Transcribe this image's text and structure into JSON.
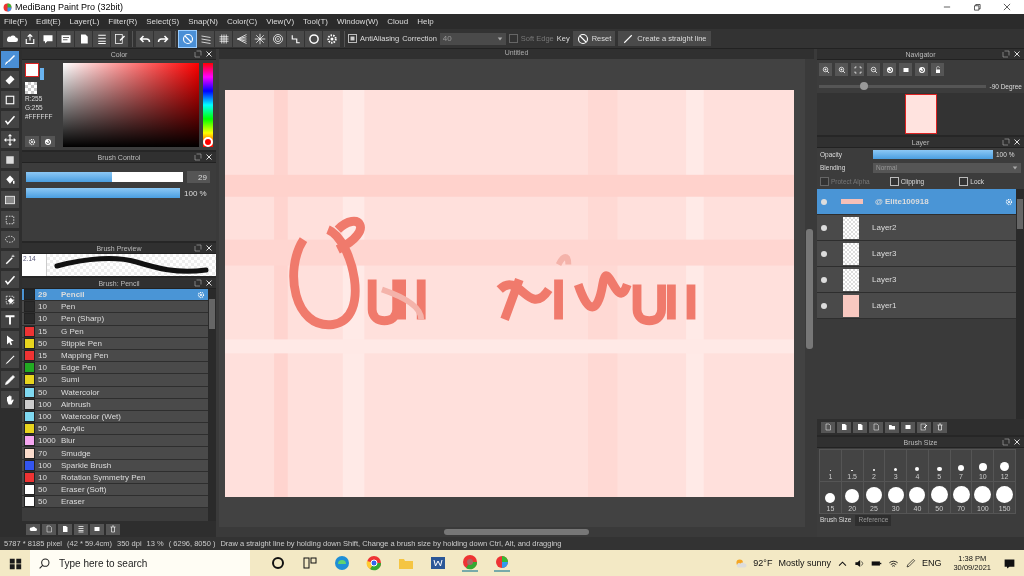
{
  "window": {
    "title": "MediBang Paint Pro (32bit)"
  },
  "menu": [
    "File(F)",
    "Edit(E)",
    "Layer(L)",
    "Filter(R)",
    "Select(S)",
    "Snap(N)",
    "Color(C)",
    "View(V)",
    "Tool(T)",
    "Window(W)",
    "Cloud",
    "Help"
  ],
  "toolbar": {
    "file_buttons": [
      {
        "kind": "cloud"
      },
      {
        "kind": "share"
      },
      {
        "kind": "comment"
      },
      {
        "kind": "note"
      },
      {
        "kind": "page"
      },
      {
        "kind": "list"
      },
      {
        "kind": "edit"
      }
    ],
    "history_buttons": [
      {
        "kind": "undo"
      },
      {
        "kind": "redo"
      }
    ],
    "snap_buttons": [
      {
        "kind": "off",
        "selected": true
      },
      {
        "kind": "parallel",
        "selected": false
      },
      {
        "kind": "grid",
        "selected": false
      },
      {
        "kind": "perspective",
        "selected": false
      },
      {
        "kind": "radial",
        "selected": false
      },
      {
        "kind": "concentric",
        "selected": false
      },
      {
        "kind": "curve",
        "selected": false
      },
      {
        "kind": "circle",
        "selected": false
      },
      {
        "kind": "gear",
        "selected": false
      }
    ],
    "antialiasing": {
      "label": "AntiAliasing",
      "checked": true
    },
    "correction": {
      "label": "Correction",
      "value": "40"
    },
    "soft_edge": {
      "label": "Soft Edge",
      "checked": false,
      "disabled": true
    },
    "key_label": "Key",
    "reset": "Reset",
    "straight_line": "Create a straight line"
  },
  "tools": [
    {
      "kind": "brush",
      "selected": true
    },
    {
      "kind": "eraser",
      "selected": false
    },
    {
      "kind": "square",
      "selected": false
    },
    {
      "kind": "select-pen",
      "selected": false
    },
    {
      "kind": "move",
      "selected": false
    },
    {
      "kind": "fill-rect",
      "selected": false
    },
    {
      "kind": "bucket",
      "selected": false
    },
    {
      "kind": "gradient",
      "selected": false
    },
    {
      "kind": "marquee",
      "selected": false
    },
    {
      "kind": "lasso",
      "selected": false
    },
    {
      "kind": "wand",
      "selected": false
    },
    {
      "kind": "select-pen",
      "selected": false
    },
    {
      "kind": "select-eraser",
      "selected": false
    },
    {
      "kind": "text",
      "selected": false
    },
    {
      "kind": "pointer",
      "selected": false
    },
    {
      "kind": "pen",
      "selected": false
    },
    {
      "kind": "eyedropper",
      "selected": false
    },
    {
      "kind": "hand",
      "selected": false
    }
  ],
  "color_panel": {
    "title": "Color",
    "hue": {
      "level": 0
    },
    "r": "R:255",
    "g": "G:255",
    "hex": "#FFFFFF"
  },
  "brush_control": {
    "title": "Brush Control",
    "size": {
      "level": 0.55,
      "reading": "29"
    },
    "opacity": {
      "level": 1,
      "reading": "100 %"
    }
  },
  "brush_preview": {
    "title": "Brush Preview",
    "value": "2.14"
  },
  "brush_list": {
    "title": "Brush: Pencil",
    "items": [
      {
        "color": "#1e2a33",
        "size": "29",
        "name": "Pencil",
        "selected": true
      },
      {
        "color": "#2a2a2a",
        "size": "10",
        "name": "Pen",
        "selected": false
      },
      {
        "color": "#2a2a2a",
        "size": "10",
        "name": "Pen (Sharp)",
        "selected": false
      },
      {
        "color": "#ee3333",
        "size": "15",
        "name": "G Pen",
        "selected": false
      },
      {
        "color": "#e8d41e",
        "size": "50",
        "name": "Stipple Pen",
        "selected": false
      },
      {
        "color": "#ee3333",
        "size": "15",
        "name": "Mapping Pen",
        "selected": false
      },
      {
        "color": "#22aa22",
        "size": "10",
        "name": "Edge Pen",
        "selected": false
      },
      {
        "color": "#e8d41e",
        "size": "50",
        "name": "Sumi",
        "selected": false
      },
      {
        "color": "#7fd8f0",
        "size": "50",
        "name": "Watercolor",
        "selected": false
      },
      {
        "color": "#cccccc",
        "size": "100",
        "name": "Airbrush",
        "selected": false
      },
      {
        "color": "#7fd8f0",
        "size": "100",
        "name": "Watercolor (Wet)",
        "selected": false
      },
      {
        "color": "#e8d41e",
        "size": "50",
        "name": "Acrylic",
        "selected": false
      },
      {
        "color": "#f5a6f0",
        "size": "1000",
        "name": "Blur",
        "selected": false
      },
      {
        "color": "#fbdccc",
        "size": "70",
        "name": "Smudge",
        "selected": false
      },
      {
        "color": "#3355ee",
        "size": "100",
        "name": "Sparkle Brush",
        "selected": false
      },
      {
        "color": "#ee3333",
        "size": "10",
        "name": "Rotation Symmetry Pen",
        "selected": false
      },
      {
        "color": "#ffffff",
        "size": "50",
        "name": "Eraser (Soft)",
        "selected": false
      },
      {
        "color": "#ffffff",
        "size": "50",
        "name": "Eraser",
        "selected": false
      }
    ]
  },
  "canvas": {
    "title": "Untitled"
  },
  "navigator": {
    "title": "Navigator",
    "rotation": {
      "level": 0.27,
      "reading": "-90 Degree"
    }
  },
  "layer_panel": {
    "title": "Layer",
    "opacity_label": "Opacity",
    "opacity": {
      "level": 1,
      "reading": "100 %"
    },
    "blending_label": "Blending",
    "blending": "Normal",
    "protect_alpha": {
      "label": "Protect Alpha",
      "checked": false,
      "disabled": true
    },
    "clipping": {
      "label": "Clipping",
      "checked": false
    },
    "lock": {
      "label": "Lock",
      "checked": false
    },
    "layers": [
      {
        "name": "@ Elite100918",
        "selected": true
      },
      {
        "name": "Layer2",
        "selected": false
      },
      {
        "name": "Layer3",
        "selected": false
      },
      {
        "name": "Layer3",
        "selected": false
      },
      {
        "name": "Layer1",
        "selected": false
      }
    ]
  },
  "brush_size": {
    "title": "Brush Size",
    "sizes": [
      "1",
      "1.5",
      "2",
      "3",
      "4",
      "5",
      "7",
      "10",
      "12",
      "15",
      "20",
      "25",
      "30",
      "40",
      "50",
      "70",
      "100",
      "150"
    ],
    "tabs": [
      {
        "label": "Brush Size",
        "selected": true
      },
      {
        "label": "Reference",
        "selected": false
      }
    ]
  },
  "status_bar": {
    "dimensions": "5787 * 8185 pixel",
    "physical": "(42 * 59.4cm)",
    "dpi": "350 dpi",
    "zoom": "13 %",
    "position": "( 6296, 8050 )",
    "hint": "Draw a straight line by holding down Shift, Change a brush size by holding down Ctrl, Alt, and dragging"
  },
  "taskbar": {
    "search_placeholder": "Type here to search",
    "temperature": "92°F",
    "weather": "Mostly sunny",
    "language": "ENG",
    "time": "1:38 PM",
    "date": "30/09/2021"
  }
}
